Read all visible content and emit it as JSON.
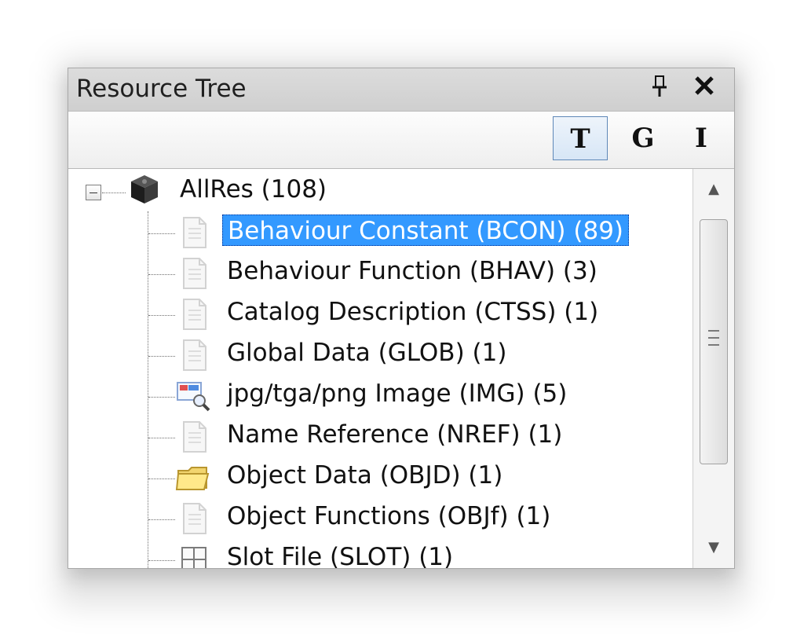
{
  "panel": {
    "title": "Resource Tree",
    "pin_glyph": "📌",
    "close_glyph": "✕"
  },
  "toolbar": {
    "buttons": [
      {
        "label": "T",
        "active": true
      },
      {
        "label": "G",
        "active": false
      },
      {
        "label": "I",
        "active": false
      }
    ]
  },
  "tree": {
    "root": {
      "label": "AllRes (108)",
      "icon": "package-icon",
      "expanded": true
    },
    "items": [
      {
        "label": "Behaviour Constant (BCON) (89)",
        "icon": "document-icon",
        "selected": true
      },
      {
        "label": "Behaviour Function (BHAV) (3)",
        "icon": "document-icon",
        "selected": false
      },
      {
        "label": "Catalog Description (CTSS) (1)",
        "icon": "document-icon",
        "selected": false
      },
      {
        "label": "Global Data (GLOB) (1)",
        "icon": "document-icon",
        "selected": false
      },
      {
        "label": "jpg/tga/png Image (IMG) (5)",
        "icon": "image-search-icon",
        "selected": false
      },
      {
        "label": "Name Reference (NREF) (1)",
        "icon": "document-icon",
        "selected": false
      },
      {
        "label": "Object Data (OBJD) (1)",
        "icon": "folder-icon",
        "selected": false
      },
      {
        "label": "Object Functions (OBJf) (1)",
        "icon": "document-icon",
        "selected": false
      },
      {
        "label": "Slot File (SLOT) (1)",
        "icon": "grid-icon",
        "selected": false
      }
    ]
  },
  "colors": {
    "selection": "#3399ff",
    "selection_border": "#003399",
    "active_button_border": "#5f88b8"
  }
}
